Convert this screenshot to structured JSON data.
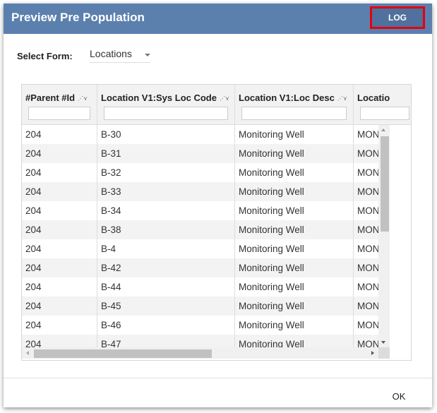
{
  "dialog": {
    "title": "Preview Pre Population",
    "log_button": "LOG",
    "ok_button": "OK",
    "accent_color": "#5b80ae",
    "highlight_color": "#e3000f"
  },
  "form": {
    "label": "Select Form:",
    "selected": "Locations"
  },
  "grid": {
    "columns": [
      {
        "label": "#Parent #Id",
        "sort_icon": "sort-icon"
      },
      {
        "label": "Location V1:Sys Loc Code",
        "sort_icon": "sort-icon"
      },
      {
        "label": "Location V1:Loc Desc",
        "sort_icon": "sort-icon"
      },
      {
        "label": "Locatio",
        "sort_icon": "sort-icon"
      }
    ],
    "rows": [
      [
        "204",
        "B-30",
        "Monitoring Well",
        "MON"
      ],
      [
        "204",
        "B-31",
        "Monitoring Well",
        "MON"
      ],
      [
        "204",
        "B-32",
        "Monitoring Well",
        "MON"
      ],
      [
        "204",
        "B-33",
        "Monitoring Well",
        "MON"
      ],
      [
        "204",
        "B-34",
        "Monitoring Well",
        "MON"
      ],
      [
        "204",
        "B-38",
        "Monitoring Well",
        "MON"
      ],
      [
        "204",
        "B-4",
        "Monitoring Well",
        "MON"
      ],
      [
        "204",
        "B-42",
        "Monitoring Well",
        "MON"
      ],
      [
        "204",
        "B-44",
        "Monitoring Well",
        "MON"
      ],
      [
        "204",
        "B-45",
        "Monitoring Well",
        "MON"
      ],
      [
        "204",
        "B-46",
        "Monitoring Well",
        "MON"
      ],
      [
        "204",
        "B-47",
        "Monitoring Well",
        "MON"
      ]
    ]
  }
}
